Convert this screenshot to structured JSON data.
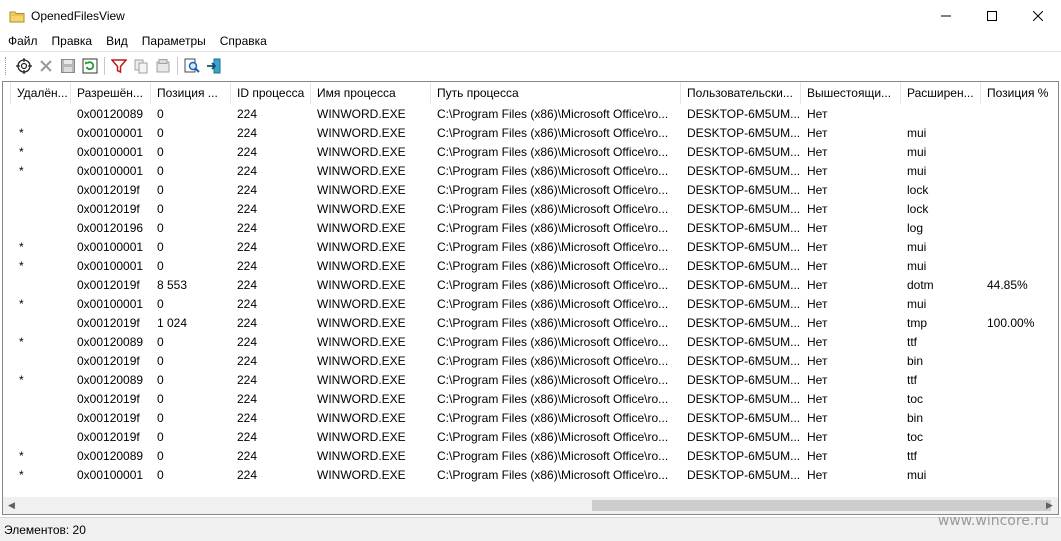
{
  "window": {
    "title": "OpenedFilesView",
    "minimize_glyph": "—",
    "maximize_glyph": "☐",
    "close_glyph": "✕"
  },
  "menu": [
    "Файл",
    "Правка",
    "Вид",
    "Параметры",
    "Справка"
  ],
  "toolbar_icons": [
    "target-icon",
    "delete-icon",
    "save-icon",
    "refresh-icon",
    "filter-icon",
    "copy-icon",
    "properties-icon",
    "find-icon",
    "exit-icon"
  ],
  "columns": [
    "",
    "Удалён...",
    "Разрешён...",
    "Позиция ...",
    "ID процесса",
    "Имя процесса",
    "Путь процесса",
    "Пользовательски...",
    "Вышестоящи...",
    "Расширен...",
    "Позиция %"
  ],
  "rows": [
    [
      "",
      "",
      "0x00120089",
      "0",
      "224",
      "WINWORD.EXE",
      "C:\\Program Files (x86)\\Microsoft Office\\ro...",
      "DESKTOP-6M5UM...",
      "Нет",
      "",
      ""
    ],
    [
      "",
      "*",
      "0x00100001",
      "0",
      "224",
      "WINWORD.EXE",
      "C:\\Program Files (x86)\\Microsoft Office\\ro...",
      "DESKTOP-6M5UM...",
      "Нет",
      "mui",
      ""
    ],
    [
      "",
      "*",
      "0x00100001",
      "0",
      "224",
      "WINWORD.EXE",
      "C:\\Program Files (x86)\\Microsoft Office\\ro...",
      "DESKTOP-6M5UM...",
      "Нет",
      "mui",
      ""
    ],
    [
      "",
      "*",
      "0x00100001",
      "0",
      "224",
      "WINWORD.EXE",
      "C:\\Program Files (x86)\\Microsoft Office\\ro...",
      "DESKTOP-6M5UM...",
      "Нет",
      "mui",
      ""
    ],
    [
      "",
      "",
      "0x0012019f",
      "0",
      "224",
      "WINWORD.EXE",
      "C:\\Program Files (x86)\\Microsoft Office\\ro...",
      "DESKTOP-6M5UM...",
      "Нет",
      "lock",
      ""
    ],
    [
      "",
      "",
      "0x0012019f",
      "0",
      "224",
      "WINWORD.EXE",
      "C:\\Program Files (x86)\\Microsoft Office\\ro...",
      "DESKTOP-6M5UM...",
      "Нет",
      "lock",
      ""
    ],
    [
      "",
      "",
      "0x00120196",
      "0",
      "224",
      "WINWORD.EXE",
      "C:\\Program Files (x86)\\Microsoft Office\\ro...",
      "DESKTOP-6M5UM...",
      "Нет",
      "log",
      ""
    ],
    [
      "",
      "*",
      "0x00100001",
      "0",
      "224",
      "WINWORD.EXE",
      "C:\\Program Files (x86)\\Microsoft Office\\ro...",
      "DESKTOP-6M5UM...",
      "Нет",
      "mui",
      ""
    ],
    [
      "",
      "*",
      "0x00100001",
      "0",
      "224",
      "WINWORD.EXE",
      "C:\\Program Files (x86)\\Microsoft Office\\ro...",
      "DESKTOP-6M5UM...",
      "Нет",
      "mui",
      ""
    ],
    [
      "",
      "",
      "0x0012019f",
      "8 553",
      "224",
      "WINWORD.EXE",
      "C:\\Program Files (x86)\\Microsoft Office\\ro...",
      "DESKTOP-6M5UM...",
      "Нет",
      "dotm",
      "44.85%"
    ],
    [
      "",
      "*",
      "0x00100001",
      "0",
      "224",
      "WINWORD.EXE",
      "C:\\Program Files (x86)\\Microsoft Office\\ro...",
      "DESKTOP-6M5UM...",
      "Нет",
      "mui",
      ""
    ],
    [
      "",
      "",
      "0x0012019f",
      "1 024",
      "224",
      "WINWORD.EXE",
      "C:\\Program Files (x86)\\Microsoft Office\\ro...",
      "DESKTOP-6M5UM...",
      "Нет",
      "tmp",
      "100.00%"
    ],
    [
      "",
      "*",
      "0x00120089",
      "0",
      "224",
      "WINWORD.EXE",
      "C:\\Program Files (x86)\\Microsoft Office\\ro...",
      "DESKTOP-6M5UM...",
      "Нет",
      "ttf",
      ""
    ],
    [
      "",
      "",
      "0x0012019f",
      "0",
      "224",
      "WINWORD.EXE",
      "C:\\Program Files (x86)\\Microsoft Office\\ro...",
      "DESKTOP-6M5UM...",
      "Нет",
      "bin",
      ""
    ],
    [
      "",
      "*",
      "0x00120089",
      "0",
      "224",
      "WINWORD.EXE",
      "C:\\Program Files (x86)\\Microsoft Office\\ro...",
      "DESKTOP-6M5UM...",
      "Нет",
      "ttf",
      ""
    ],
    [
      "",
      "",
      "0x0012019f",
      "0",
      "224",
      "WINWORD.EXE",
      "C:\\Program Files (x86)\\Microsoft Office\\ro...",
      "DESKTOP-6M5UM...",
      "Нет",
      "toc",
      ""
    ],
    [
      "",
      "",
      "0x0012019f",
      "0",
      "224",
      "WINWORD.EXE",
      "C:\\Program Files (x86)\\Microsoft Office\\ro...",
      "DESKTOP-6M5UM...",
      "Нет",
      "bin",
      ""
    ],
    [
      "",
      "",
      "0x0012019f",
      "0",
      "224",
      "WINWORD.EXE",
      "C:\\Program Files (x86)\\Microsoft Office\\ro...",
      "DESKTOP-6M5UM...",
      "Нет",
      "toc",
      ""
    ],
    [
      "",
      "*",
      "0x00120089",
      "0",
      "224",
      "WINWORD.EXE",
      "C:\\Program Files (x86)\\Microsoft Office\\ro...",
      "DESKTOP-6M5UM...",
      "Нет",
      "ttf",
      ""
    ],
    [
      "",
      "*",
      "0x00100001",
      "0",
      "224",
      "WINWORD.EXE",
      "C:\\Program Files (x86)\\Microsoft Office\\ro...",
      "DESKTOP-6M5UM...",
      "Нет",
      "mui",
      ""
    ]
  ],
  "status": {
    "text": "Элементов: 20"
  },
  "watermark": "www.wincore.ru",
  "scroll": {
    "left_glyph": "◀",
    "right_glyph": "▶",
    "horizontal_position": 0.56,
    "horizontal_visible_fraction": 0.45
  }
}
